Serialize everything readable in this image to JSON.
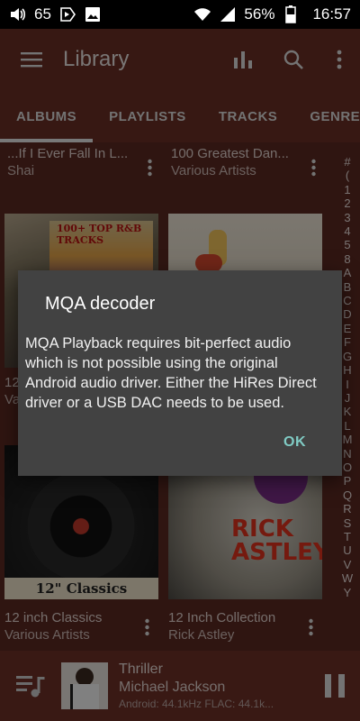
{
  "status_bar": {
    "volume_level": "65",
    "battery": "56%",
    "time": "16:57",
    "icons": [
      "volume-icon",
      "play-store-icon",
      "image-icon",
      "wifi-icon",
      "signal-icon",
      "battery-icon"
    ]
  },
  "toolbar": {
    "title": "Library",
    "icons": [
      "menu-icon",
      "equalizer-icon",
      "search-icon",
      "more-vert-icon"
    ]
  },
  "tabs": [
    "ALBUMS",
    "PLAYLISTS",
    "TRACKS",
    "GENRES"
  ],
  "active_tab": "ALBUMS",
  "albums": [
    {
      "title": "...If I Ever Fall In L...",
      "artist": "Shai"
    },
    {
      "title": "100 Greatest Dan...",
      "artist": "Various Artists"
    },
    {
      "title": "100+ TOP R&B TRACKS",
      "artist": ""
    },
    {
      "title": "",
      "artist": ""
    },
    {
      "title": "12 inch Classics",
      "artist": "Various Artists",
      "cover_text": "12\" Classics"
    },
    {
      "title": "12 Inch Collection",
      "artist": "Rick Astley",
      "cover_text": "RICK ASTLEY"
    }
  ],
  "partial_row_text": {
    "left_1": "12",
    "left_2": "Va"
  },
  "alphabet": [
    "#",
    "(",
    "1",
    "2",
    "3",
    "4",
    "5",
    "8",
    "A",
    "B",
    "C",
    "D",
    "E",
    "F",
    "G",
    "H",
    "I",
    "J",
    "K",
    "L",
    "M",
    "N",
    "O",
    "P",
    "Q",
    "R",
    "S",
    "T",
    "U",
    "V",
    "W",
    "Y"
  ],
  "player": {
    "title": "Thriller",
    "artist": "Michael Jackson",
    "format": "Android: 44.1kHz  FLAC: 44.1k..."
  },
  "dialog": {
    "title": "MQA decoder",
    "message": "MQA Playback requires bit-perfect audio which is not possible using the original Android audio driver. Either the HiRes Direct driver or a USB DAC needs to be used.",
    "ok_label": "OK"
  },
  "colors": {
    "app_bg": "#5b2a22",
    "toolbar_bg": "#6a2e25",
    "dialog_bg": "#424242",
    "accent": "#80cbc4"
  }
}
